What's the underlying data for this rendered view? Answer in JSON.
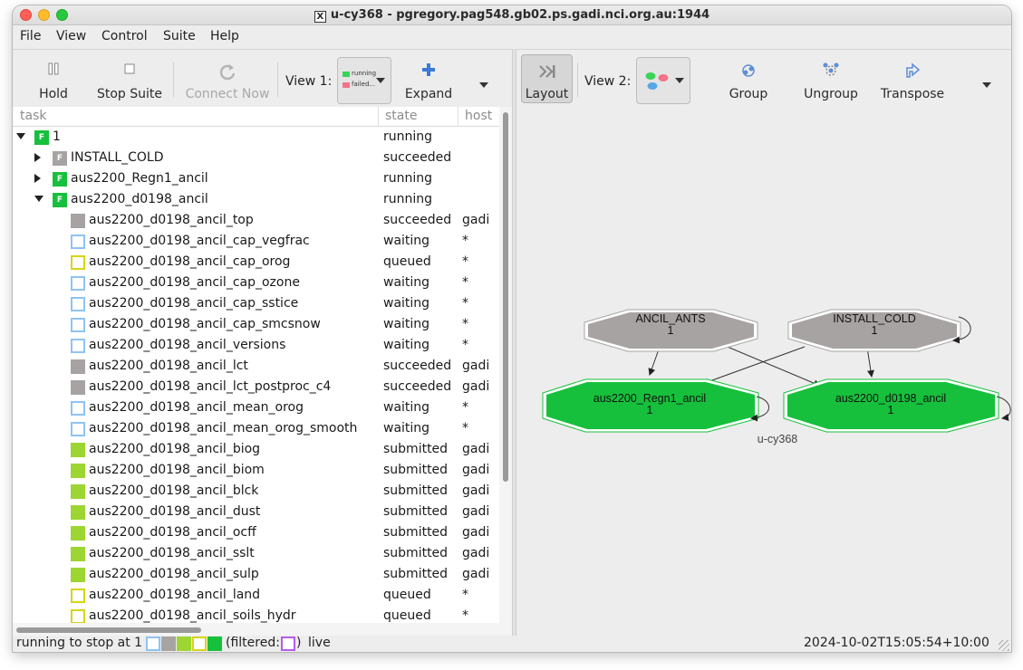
{
  "window": {
    "title": "u-cy368 - pgregory.pag548.gb02.ps.gadi.nci.org.au:1944"
  },
  "menu": [
    "File",
    "View",
    "Control",
    "Suite",
    "Help"
  ],
  "toolbar_left": {
    "hold": "Hold",
    "stop_suite": "Stop Suite",
    "connect_now": "Connect Now",
    "view1_label": "View 1:",
    "view1_legend": [
      "running",
      "failed..."
    ],
    "expand": "Expand"
  },
  "toolbar_right": {
    "layout": "Layout",
    "view2_label": "View 2:",
    "group": "Group",
    "ungroup": "Ungroup",
    "transpose": "Transpose"
  },
  "tree": {
    "headers": {
      "task": "task",
      "state": "state",
      "host": "host"
    },
    "rows": [
      {
        "name": "1",
        "state": "running",
        "host": "",
        "kind": "family",
        "status": "running",
        "expander": "open",
        "level": 0
      },
      {
        "name": "INSTALL_COLD",
        "state": "succeeded",
        "host": "",
        "kind": "family",
        "status": "succeeded",
        "expander": "closed",
        "level": 1
      },
      {
        "name": "aus2200_Regn1_ancil",
        "state": "running",
        "host": "",
        "kind": "family",
        "status": "running",
        "expander": "closed",
        "level": 1
      },
      {
        "name": "aus2200_d0198_ancil",
        "state": "running",
        "host": "",
        "kind": "family",
        "status": "running",
        "expander": "open",
        "level": 1
      },
      {
        "name": "aus2200_d0198_ancil_top",
        "state": "succeeded",
        "host": "gadi",
        "kind": "task",
        "status": "succeeded",
        "level": 2
      },
      {
        "name": "aus2200_d0198_ancil_cap_vegfrac",
        "state": "waiting",
        "host": "*",
        "kind": "task",
        "status": "waiting",
        "level": 2
      },
      {
        "name": "aus2200_d0198_ancil_cap_orog",
        "state": "queued",
        "host": "*",
        "kind": "task",
        "status": "queued",
        "level": 2
      },
      {
        "name": "aus2200_d0198_ancil_cap_ozone",
        "state": "waiting",
        "host": "*",
        "kind": "task",
        "status": "waiting",
        "level": 2
      },
      {
        "name": "aus2200_d0198_ancil_cap_sstice",
        "state": "waiting",
        "host": "*",
        "kind": "task",
        "status": "waiting",
        "level": 2
      },
      {
        "name": "aus2200_d0198_ancil_cap_smcsnow",
        "state": "waiting",
        "host": "*",
        "kind": "task",
        "status": "waiting",
        "level": 2
      },
      {
        "name": "aus2200_d0198_ancil_versions",
        "state": "waiting",
        "host": "*",
        "kind": "task",
        "status": "waiting",
        "level": 2
      },
      {
        "name": "aus2200_d0198_ancil_lct",
        "state": "succeeded",
        "host": "gadi",
        "kind": "task",
        "status": "succeeded",
        "level": 2
      },
      {
        "name": "aus2200_d0198_ancil_lct_postproc_c4",
        "state": "succeeded",
        "host": "gadi",
        "kind": "task",
        "status": "succeeded",
        "level": 2
      },
      {
        "name": "aus2200_d0198_ancil_mean_orog",
        "state": "waiting",
        "host": "*",
        "kind": "task",
        "status": "waiting",
        "level": 2
      },
      {
        "name": "aus2200_d0198_ancil_mean_orog_smooth",
        "state": "waiting",
        "host": "*",
        "kind": "task",
        "status": "waiting",
        "level": 2
      },
      {
        "name": "aus2200_d0198_ancil_biog",
        "state": "submitted",
        "host": "gadi",
        "kind": "task",
        "status": "submitted",
        "level": 2
      },
      {
        "name": "aus2200_d0198_ancil_biom",
        "state": "submitted",
        "host": "gadi",
        "kind": "task",
        "status": "submitted",
        "level": 2
      },
      {
        "name": "aus2200_d0198_ancil_blck",
        "state": "submitted",
        "host": "gadi",
        "kind": "task",
        "status": "submitted",
        "level": 2
      },
      {
        "name": "aus2200_d0198_ancil_dust",
        "state": "submitted",
        "host": "gadi",
        "kind": "task",
        "status": "submitted",
        "level": 2
      },
      {
        "name": "aus2200_d0198_ancil_ocff",
        "state": "submitted",
        "host": "gadi",
        "kind": "task",
        "status": "submitted",
        "level": 2
      },
      {
        "name": "aus2200_d0198_ancil_sslt",
        "state": "submitted",
        "host": "gadi",
        "kind": "task",
        "status": "submitted",
        "level": 2
      },
      {
        "name": "aus2200_d0198_ancil_sulp",
        "state": "submitted",
        "host": "gadi",
        "kind": "task",
        "status": "submitted",
        "level": 2
      },
      {
        "name": "aus2200_d0198_ancil_land",
        "state": "queued",
        "host": "*",
        "kind": "task",
        "status": "queued",
        "level": 2
      },
      {
        "name": "aus2200_d0198_ancil_soils_hydr",
        "state": "queued",
        "host": "*",
        "kind": "task",
        "status": "queued",
        "level": 2
      }
    ]
  },
  "graph": {
    "nodes": [
      {
        "id": "ANCIL_ANTS",
        "label": "ANCIL_ANTS",
        "cycle": "1",
        "status": "succeeded"
      },
      {
        "id": "INSTALL_COLD",
        "label": "INSTALL_COLD",
        "cycle": "1",
        "status": "succeeded"
      },
      {
        "id": "aus2200_Regn1_ancil",
        "label": "aus2200_Regn1_ancil",
        "cycle": "1",
        "status": "running"
      },
      {
        "id": "aus2200_d0198_ancil",
        "label": "aus2200_d0198_ancil",
        "cycle": "1",
        "status": "running"
      }
    ],
    "edges": [
      [
        "ANCIL_ANTS",
        "aus2200_Regn1_ancil"
      ],
      [
        "ANCIL_ANTS",
        "aus2200_d0198_ancil"
      ],
      [
        "INSTALL_COLD",
        "aus2200_Regn1_ancil"
      ],
      [
        "INSTALL_COLD",
        "aus2200_d0198_ancil"
      ]
    ],
    "suite_label": "u-cy368"
  },
  "status_bar": {
    "message": "running to stop at 1",
    "filtered_open": "(filtered:",
    "filtered_close": ")",
    "mode": "live",
    "timestamp": "2024-10-02T15:05:54+10:00"
  },
  "colors": {
    "running": "#17c03c",
    "succeeded": "#a8a3a3",
    "waiting": "#8fc3f5",
    "queued": "#d8d418",
    "submitted": "#9dd532",
    "filtered": "#b55cf0"
  }
}
